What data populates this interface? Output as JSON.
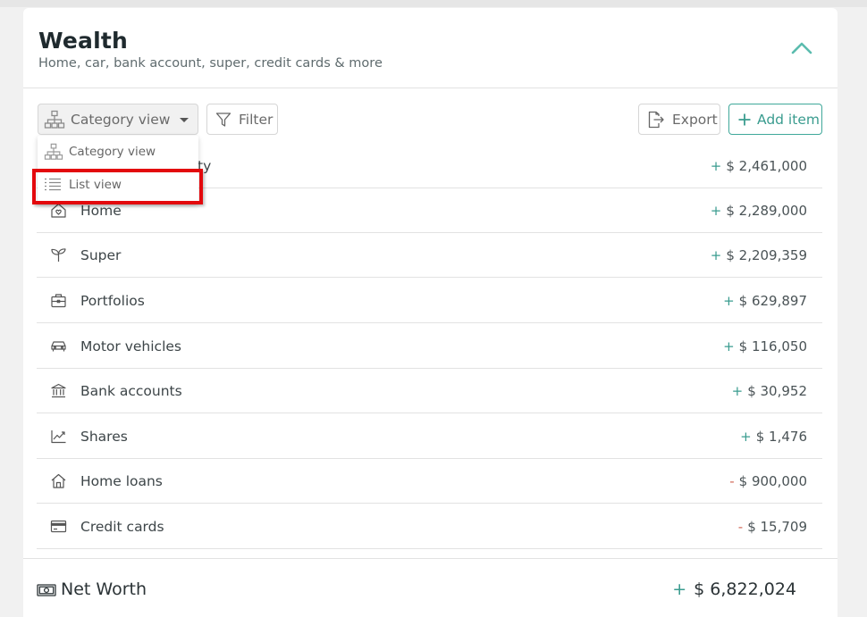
{
  "header": {
    "title": "Wealth",
    "subtitle": "Home, car, bank account, super, credit cards & more"
  },
  "toolbar": {
    "view_select_label": "Category view",
    "filter_label": "Filter",
    "export_label": "Export",
    "add_label": "Add item"
  },
  "view_menu": {
    "items": [
      {
        "label": "Category view",
        "icon": "hierarchy-icon"
      },
      {
        "label": "List view",
        "icon": "list-icon",
        "highlighted": true
      }
    ]
  },
  "rows": [
    {
      "label": "ty",
      "sign": "+",
      "value": "$ 2,461,000"
    },
    {
      "label": "Home",
      "icon": "home-heart-icon",
      "sign": "+",
      "value": "$ 2,289,000"
    },
    {
      "label": "Super",
      "icon": "sprout-icon",
      "sign": "+",
      "value": "$ 2,209,359"
    },
    {
      "label": "Portfolios",
      "icon": "briefcase-icon",
      "sign": "+",
      "value": "$ 629,897"
    },
    {
      "label": "Motor vehicles",
      "icon": "car-icon",
      "sign": "+",
      "value": "$ 116,050"
    },
    {
      "label": "Bank accounts",
      "icon": "bank-icon",
      "sign": "+",
      "value": "$ 30,952"
    },
    {
      "label": "Shares",
      "icon": "chart-icon",
      "sign": "+",
      "value": "$ 1,476"
    },
    {
      "label": "Home loans",
      "icon": "house-icon",
      "sign": "-",
      "value": "$ 900,000"
    },
    {
      "label": "Credit cards",
      "icon": "credit-card-icon",
      "sign": "-",
      "value": "$ 15,709"
    }
  ],
  "net_worth": {
    "label": "Net Worth",
    "sign": "+",
    "value": "$ 6,822,024"
  },
  "colors": {
    "accent": "#3a9c8f",
    "negative": "#d26a5a",
    "highlight": "#e3090d"
  }
}
